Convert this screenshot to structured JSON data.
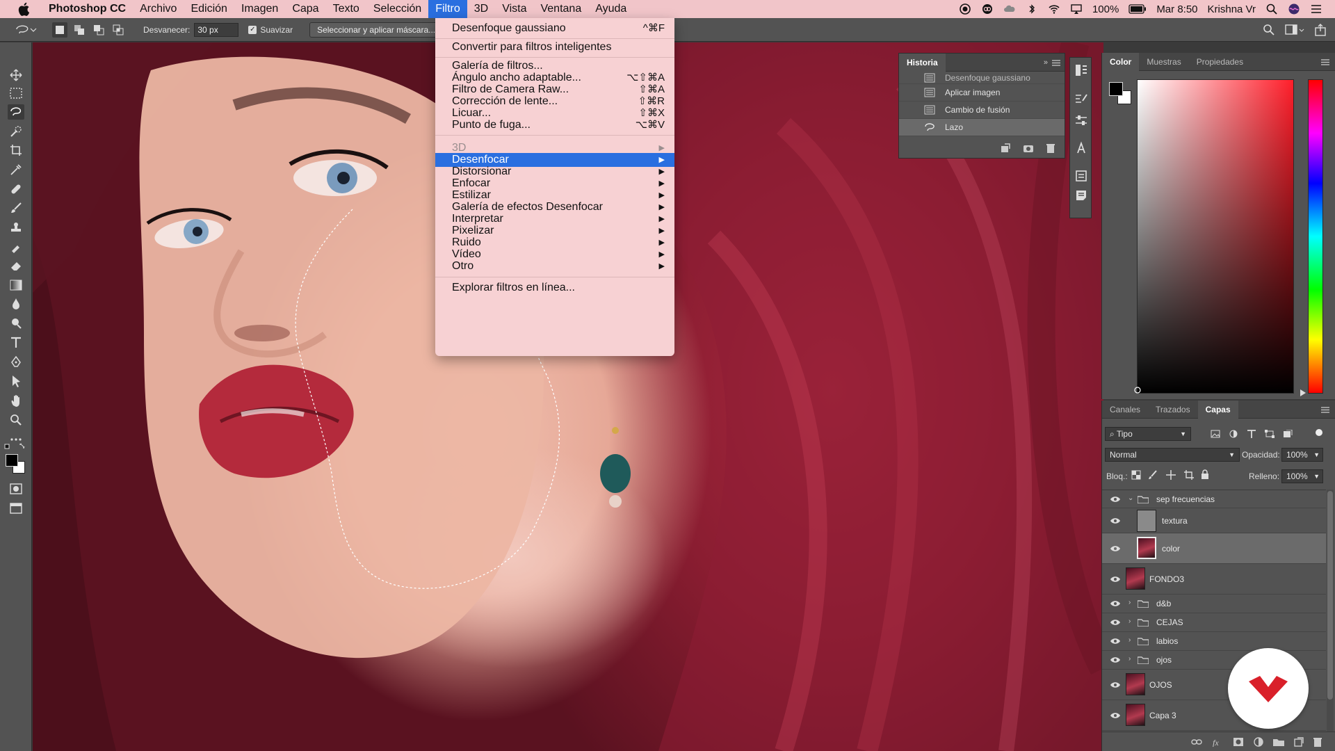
{
  "menubar": {
    "app": "Photoshop CC",
    "items": [
      "Archivo",
      "Edición",
      "Imagen",
      "Capa",
      "Texto",
      "Selección",
      "Filtro",
      "3D",
      "Vista",
      "Ventana",
      "Ayuda"
    ],
    "active": "Filtro",
    "battery": "100%",
    "clock": "Mar 8:50",
    "user": "Krishna Vr"
  },
  "options": {
    "feather_label": "Desvanecer:",
    "feather_value": "30 px",
    "smooth_label": "Suavizar",
    "mask_button": "Seleccionar y aplicar máscara..."
  },
  "filter_menu": {
    "last_filter": {
      "label": "Desenfoque gaussiano",
      "shortcut": "^⌘F"
    },
    "smart": "Convertir para filtros inteligentes",
    "gallery": {
      "label": "Galería de filtros..."
    },
    "wide_angle": {
      "label": "Ángulo ancho adaptable...",
      "shortcut": "⌥⇧⌘A"
    },
    "camera_raw": {
      "label": "Filtro de Camera Raw...",
      "shortcut": "⇧⌘A"
    },
    "lens": {
      "label": "Corrección de lente...",
      "shortcut": "⇧⌘R"
    },
    "liquify": {
      "label": "Licuar...",
      "shortcut": "⇧⌘X"
    },
    "vanishing": {
      "label": "Punto de fuga...",
      "shortcut": "⌥⌘V"
    },
    "submenus": [
      "3D",
      "Desenfocar",
      "Distorsionar",
      "Enfocar",
      "Estilizar",
      "Galería de efectos Desenfocar",
      "Interpretar",
      "Pixelizar",
      "Ruido",
      "Vídeo",
      "Otro"
    ],
    "highlighted": "Desenfocar",
    "disabled": "3D",
    "browse": "Explorar filtros en línea..."
  },
  "history": {
    "title": "Historia",
    "items": [
      "Desenfoque gaussiano",
      "Aplicar imagen",
      "Cambio de fusión",
      "Lazo"
    ],
    "selected": "Lazo"
  },
  "color_panel": {
    "tabs": [
      "Color",
      "Muestras",
      "Propiedades"
    ],
    "active": "Color",
    "hue_color": "#ff1e2a"
  },
  "layers_panel": {
    "tabs": [
      "Canales",
      "Trazados",
      "Capas"
    ],
    "active": "Capas",
    "filter": "Tipo",
    "blend_mode": "Normal",
    "opacity_label": "Opacidad:",
    "opacity": "100%",
    "lock_label": "Bloq.:",
    "fill_label": "Relleno:",
    "fill": "100%",
    "layers": [
      {
        "name": "sep frecuencias",
        "kind": "group-open"
      },
      {
        "name": "textura",
        "kind": "layer-gray"
      },
      {
        "name": "color",
        "kind": "layer-photo",
        "selected": true
      },
      {
        "name": "FONDO3",
        "kind": "layer-photo"
      },
      {
        "name": "d&b",
        "kind": "group"
      },
      {
        "name": "CEJAS",
        "kind": "group"
      },
      {
        "name": "labios",
        "kind": "group"
      },
      {
        "name": "ojos",
        "kind": "group"
      },
      {
        "name": "OJOS",
        "kind": "layer-photo"
      },
      {
        "name": "Capa 3",
        "kind": "layer-photo"
      }
    ]
  },
  "colors": {
    "menubar": "#f1c5c9",
    "highlight": "#2a6fe0",
    "panel": "#535353",
    "logo": "#d9202a"
  }
}
